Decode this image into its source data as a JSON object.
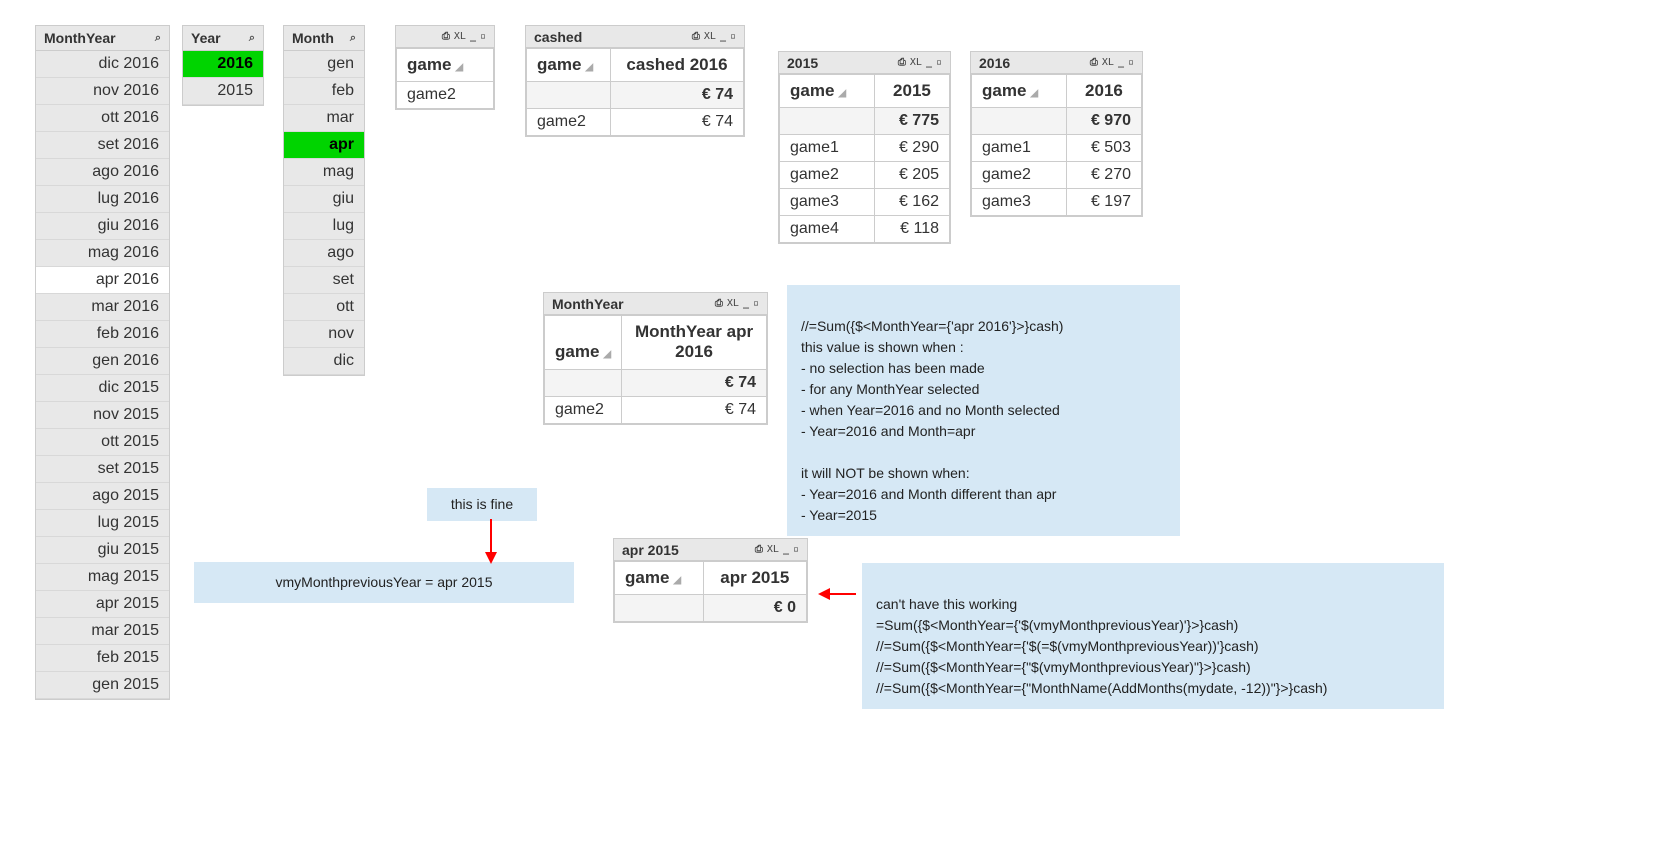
{
  "listboxes": {
    "monthyear": {
      "title": "MonthYear",
      "items": [
        {
          "label": "dic 2016",
          "state": "normal"
        },
        {
          "label": "nov 2016",
          "state": "normal"
        },
        {
          "label": "ott 2016",
          "state": "normal"
        },
        {
          "label": "set 2016",
          "state": "normal"
        },
        {
          "label": "ago 2016",
          "state": "normal"
        },
        {
          "label": "lug 2016",
          "state": "normal"
        },
        {
          "label": "giu 2016",
          "state": "normal"
        },
        {
          "label": "mag 2016",
          "state": "normal"
        },
        {
          "label": "apr 2016",
          "state": "possible-white"
        },
        {
          "label": "mar 2016",
          "state": "normal"
        },
        {
          "label": "feb 2016",
          "state": "normal"
        },
        {
          "label": "gen 2016",
          "state": "normal"
        },
        {
          "label": "dic 2015",
          "state": "normal"
        },
        {
          "label": "nov 2015",
          "state": "normal"
        },
        {
          "label": "ott 2015",
          "state": "normal"
        },
        {
          "label": "set 2015",
          "state": "normal"
        },
        {
          "label": "ago 2015",
          "state": "normal"
        },
        {
          "label": "lug 2015",
          "state": "normal"
        },
        {
          "label": "giu 2015",
          "state": "normal"
        },
        {
          "label": "mag 2015",
          "state": "normal"
        },
        {
          "label": "apr 2015",
          "state": "normal"
        },
        {
          "label": "mar 2015",
          "state": "normal"
        },
        {
          "label": "feb 2015",
          "state": "normal"
        },
        {
          "label": "gen 2015",
          "state": "normal"
        }
      ]
    },
    "year": {
      "title": "Year",
      "items": [
        {
          "label": "2016",
          "state": "selected-green"
        },
        {
          "label": "2015",
          "state": "normal"
        }
      ]
    },
    "month": {
      "title": "Month",
      "items": [
        {
          "label": "gen",
          "state": "normal"
        },
        {
          "label": "feb",
          "state": "normal"
        },
        {
          "label": "mar",
          "state": "normal"
        },
        {
          "label": "apr",
          "state": "selected-green"
        },
        {
          "label": "mag",
          "state": "normal"
        },
        {
          "label": "giu",
          "state": "normal"
        },
        {
          "label": "lug",
          "state": "normal"
        },
        {
          "label": "ago",
          "state": "normal"
        },
        {
          "label": "set",
          "state": "normal"
        },
        {
          "label": "ott",
          "state": "normal"
        },
        {
          "label": "nov",
          "state": "normal"
        },
        {
          "label": "dic",
          "state": "normal"
        }
      ]
    }
  },
  "charts": {
    "game_simple": {
      "dim_label": "game",
      "rows": [
        {
          "dim": "game2"
        }
      ]
    },
    "cashed": {
      "title": "cashed",
      "dim_label": "game",
      "expr_label": "cashed 2016",
      "total": "€ 74",
      "rows": [
        {
          "dim": "game2",
          "val": "€ 74"
        }
      ]
    },
    "y2015": {
      "title": "2015",
      "dim_label": "game",
      "expr_label": "2015",
      "total": "€ 775",
      "rows": [
        {
          "dim": "game1",
          "val": "€ 290"
        },
        {
          "dim": "game2",
          "val": "€ 205"
        },
        {
          "dim": "game3",
          "val": "€ 162"
        },
        {
          "dim": "game4",
          "val": "€ 118"
        }
      ]
    },
    "y2016": {
      "title": "2016",
      "dim_label": "game",
      "expr_label": "2016",
      "total": "€ 970",
      "rows": [
        {
          "dim": "game1",
          "val": "€ 503"
        },
        {
          "dim": "game2",
          "val": "€ 270"
        },
        {
          "dim": "game3",
          "val": "€ 197"
        }
      ]
    },
    "monthyear": {
      "title": "MonthYear",
      "dim_label": "game",
      "expr_label": "MonthYear apr 2016",
      "total": "€ 74",
      "rows": [
        {
          "dim": "game2",
          "val": "€ 74"
        }
      ]
    },
    "apr2015": {
      "title": "apr 2015",
      "dim_label": "game",
      "expr_label": "apr 2015",
      "total": "€ 0",
      "rows": []
    }
  },
  "textboxes": {
    "fine_label": "this is fine",
    "prev_year": "vmyMonthpreviousYear = apr 2015",
    "note1": "//=Sum({$<MonthYear={'apr 2016'}>}cash)\nthis value is shown when :\n- no selection has been made\n- for any MonthYear selected\n- when Year=2016 and no Month selected\n- Year=2016 and Month=apr\n\nit will NOT be shown when:\n- Year=2016 and Month different than apr\n- Year=2015",
    "note2": "can't have this working\n=Sum({$<MonthYear={'$(vmyMonthpreviousYear)'}>}cash)\n//=Sum({$<MonthYear={'$(=$(vmyMonthpreviousYear))'}cash)\n//=Sum({$<MonthYear={\"$(vmyMonthpreviousYear)\"}>}cash)\n//=Sum({$<MonthYear={\"MonthName(AddMonths(mydate,  -12))\"}>}cash)"
  },
  "icons": {
    "search": "⌕",
    "xl": "XL",
    "print": "⎙",
    "min": "_",
    "max": "▫",
    "sort": "◢"
  }
}
